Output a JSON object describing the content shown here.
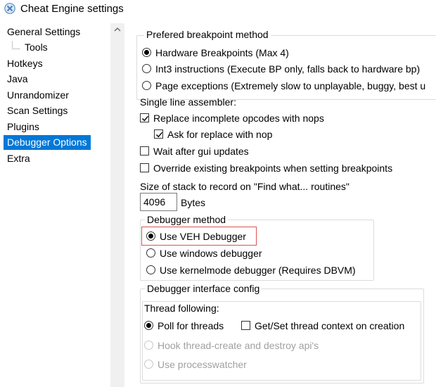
{
  "window": {
    "title": "Cheat Engine settings",
    "icon": "cheat-engine-logo"
  },
  "sidebar": {
    "items": [
      {
        "label": "General Settings"
      },
      {
        "label": "Tools"
      },
      {
        "label": "Hotkeys"
      },
      {
        "label": "Java"
      },
      {
        "label": "Unrandomizer"
      },
      {
        "label": "Scan Settings"
      },
      {
        "label": "Plugins"
      },
      {
        "label": "Debugger Options"
      },
      {
        "label": "Extra"
      }
    ],
    "selected": "Debugger Options"
  },
  "breakpoint": {
    "group_title": "Prefered breakpoint method",
    "options": [
      {
        "label": "Hardware Breakpoints (Max 4)",
        "checked": true
      },
      {
        "label": "Int3 instructions (Execute BP only, falls back to hardware bp)",
        "checked": false
      },
      {
        "label": "Page exceptions (Extremely slow to unplayable, buggy, best u",
        "checked": false
      }
    ]
  },
  "assembler": {
    "label": "Single line assembler:",
    "replace_label": "Replace incomplete opcodes with nops",
    "ask_label": "Ask for replace with nop"
  },
  "misc": {
    "wait_label": "Wait after gui updates",
    "override_label": "Override existing breakpoints when setting breakpoints"
  },
  "stack": {
    "label": "Size of stack to record on \"Find what... routines\"",
    "value": "4096",
    "unit": "Bytes"
  },
  "debugger_method": {
    "group_title": "Debugger method",
    "options": [
      {
        "label": "Use VEH Debugger",
        "checked": true
      },
      {
        "label": "Use windows debugger",
        "checked": false
      },
      {
        "label": "Use kernelmode debugger (Requires DBVM)",
        "checked": false
      }
    ],
    "highlight_color": "#d9534f"
  },
  "interface_config": {
    "group_title": "Debugger interface config",
    "thread_following_label": "Thread following:",
    "poll_label": "Poll for threads",
    "getset_label": "Get/Set thread context on creation",
    "hook_label": "Hook thread-create and destroy api's",
    "processwatcher_label": "Use processwatcher"
  },
  "colors": {
    "selection": "#0078d7",
    "disabled_text": "#a0a0a0"
  }
}
